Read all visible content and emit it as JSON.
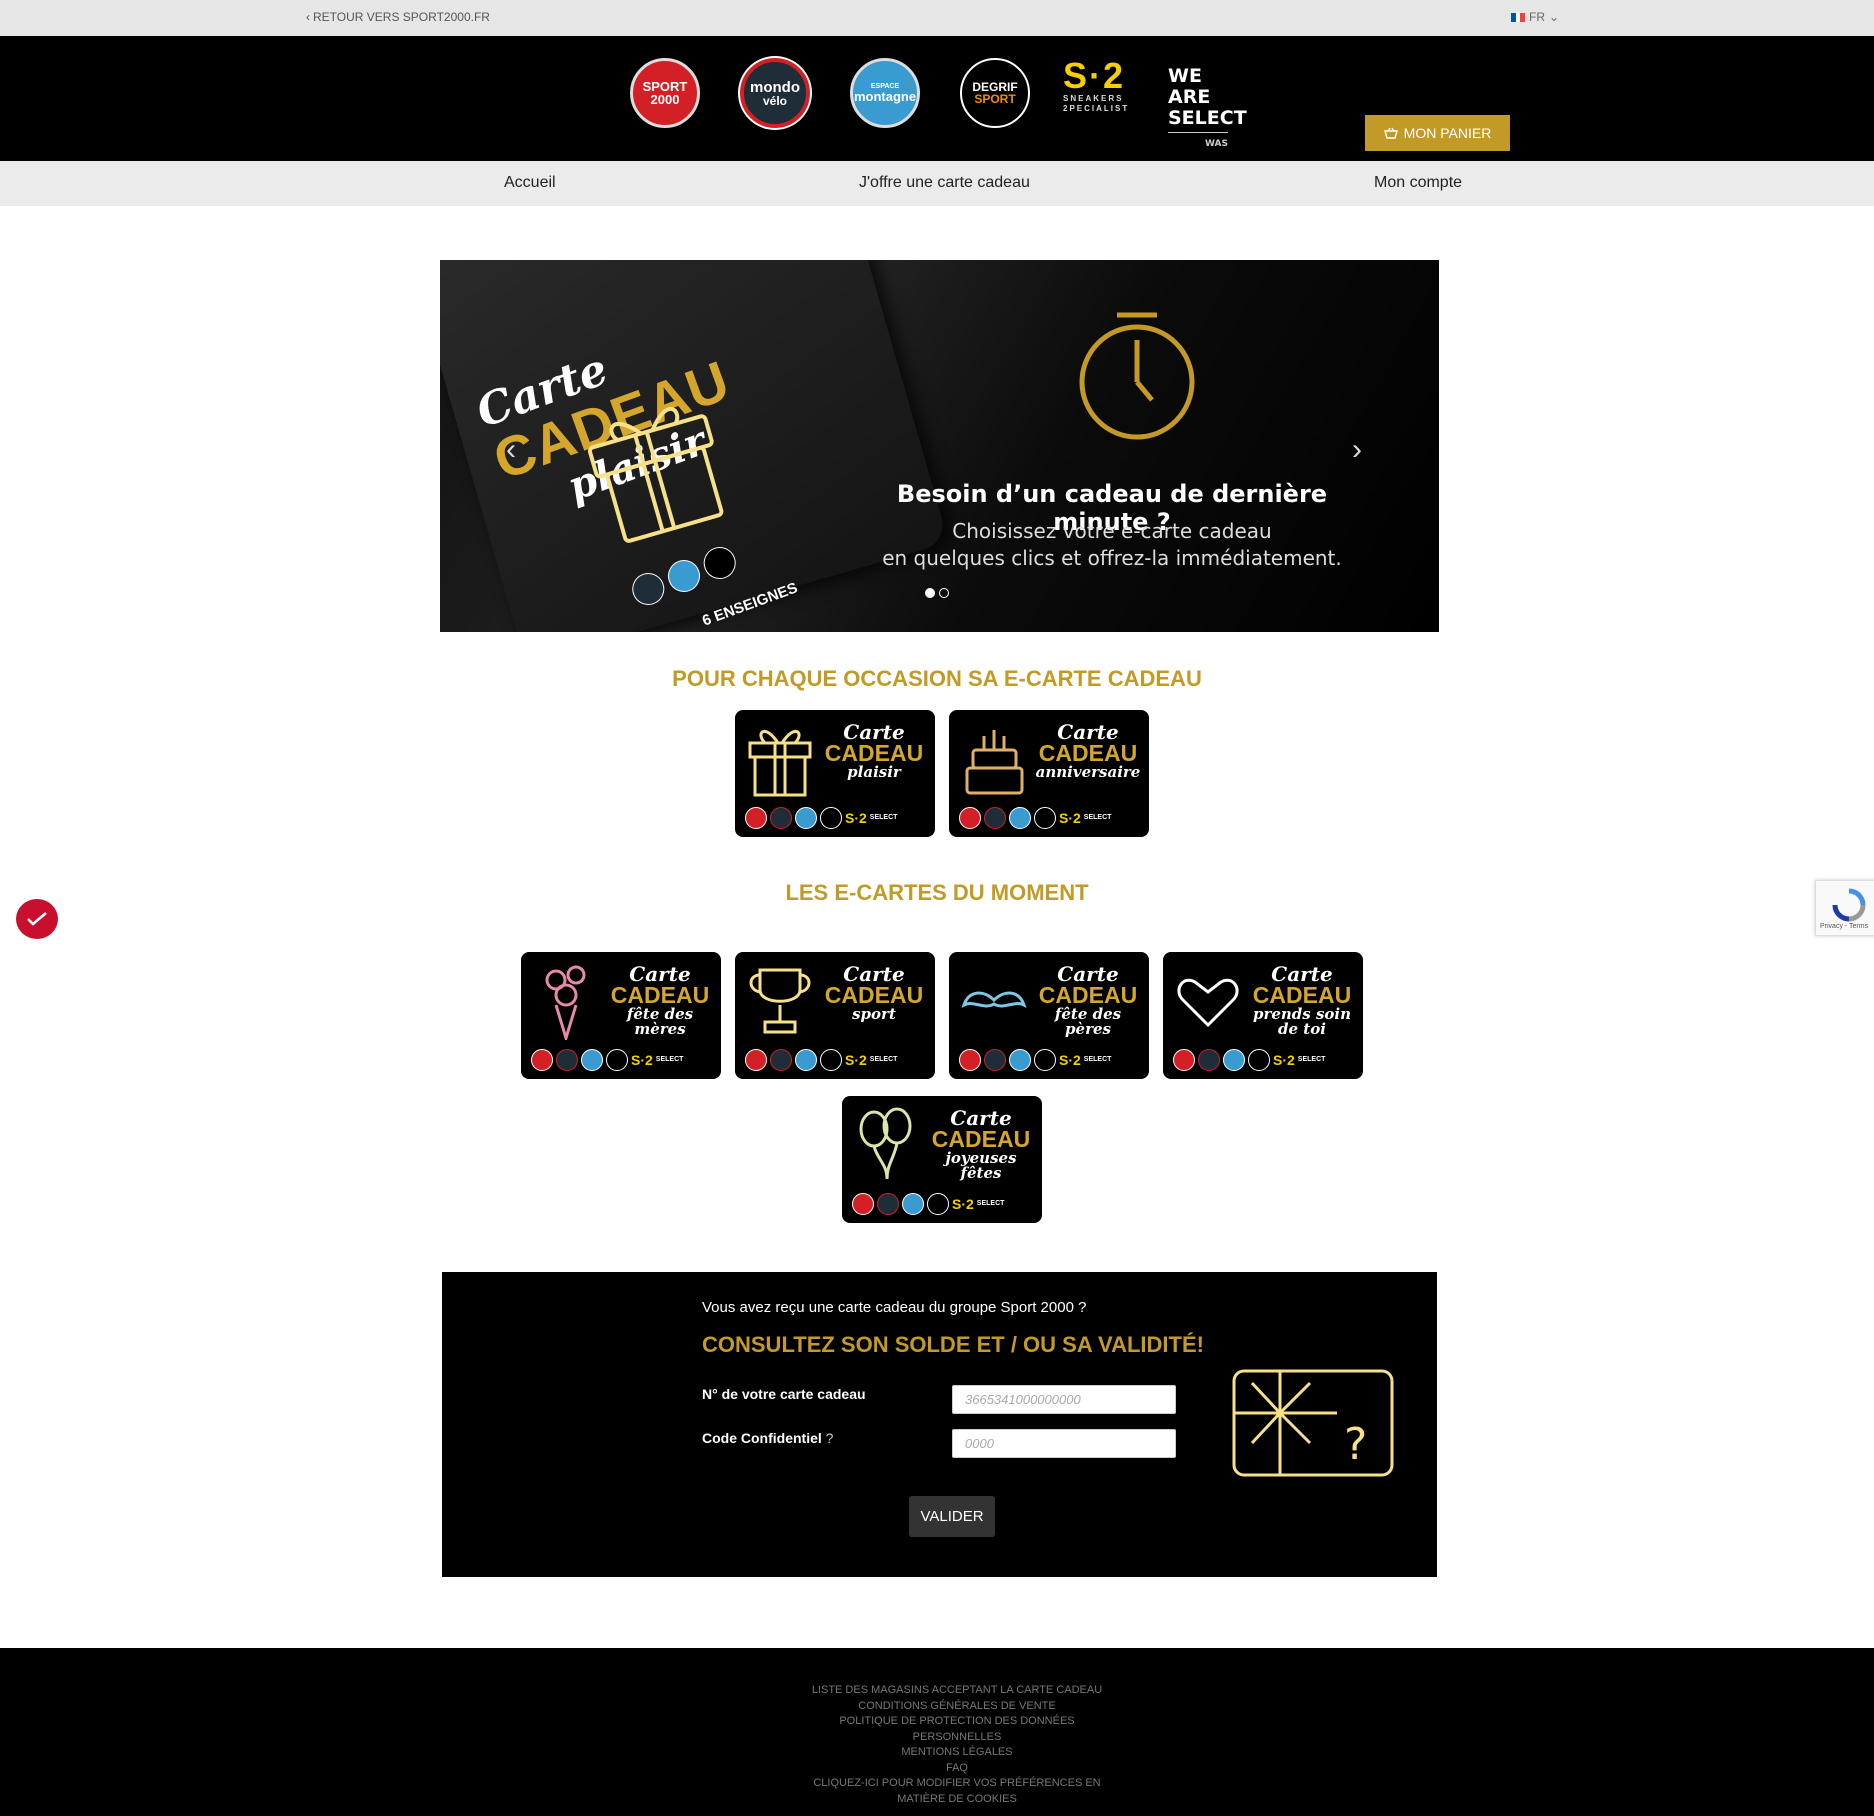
{
  "topbar": {
    "back_label": "RETOUR VERS SPORT2000.FR",
    "lang": "FR"
  },
  "brands": {
    "sport2000_l1": "SPORT",
    "sport2000_l2": "2000",
    "mondovelo_l1": "mondo",
    "mondovelo_l2": "vélo",
    "montagne_l1": "ESPACE",
    "montagne_l2": "montagne",
    "degrif_l1": "DEGRIF",
    "degrif_l2": "SPORT",
    "s2_big": "S·2",
    "s2_l1": "SNEAKERS",
    "s2_l2": "2PECIALIST",
    "was_l1": "WE ARE",
    "was_l2": "SELECT",
    "was_l3": "WAS"
  },
  "header": {
    "cart_label": "MON PANIER"
  },
  "nav": {
    "items": [
      "Accueil",
      "J'offre une carte cadeau",
      "Mon compte"
    ]
  },
  "hero": {
    "card_l1": "Carte",
    "card_l2": "CADEAU",
    "card_l3": "plaisir",
    "card_enseignes": "6 ENSEIGNES",
    "title": "Besoin d’un cadeau de dernière minute ?",
    "sub_l1": "Choisissez votre e-carte cadeau",
    "sub_l2": "en quelques clics et offrez-la immédiatement.",
    "slides": 2,
    "active_slide": 1
  },
  "occasion": {
    "title": "POUR CHAQUE OCCASION SA E-CARTE CADEAU",
    "cards": [
      {
        "l1": "Carte",
        "l2": "CADEAU",
        "l3": "plaisir"
      },
      {
        "l1": "Carte",
        "l2": "CADEAU",
        "l3": "anniversaire"
      }
    ]
  },
  "moment": {
    "title": "LES E-CARTES DU MOMENT",
    "cards": [
      {
        "l1": "Carte",
        "l2": "CADEAU",
        "l3": "fête des mères"
      },
      {
        "l1": "Carte",
        "l2": "CADEAU",
        "l3": "sport"
      },
      {
        "l1": "Carte",
        "l2": "CADEAU",
        "l3": "fête des pères"
      },
      {
        "l1": "Carte",
        "l2": "CADEAU",
        "l3": "prends soin de toi"
      },
      {
        "l1": "Carte",
        "l2": "CADEAU",
        "l3": "joyeuses fêtes"
      }
    ]
  },
  "balance": {
    "question": "Vous avez reçu une carte cadeau du groupe Sport 2000 ?",
    "title": "CONSULTEZ SON SOLDE ET / OU SA VALIDITÉ!",
    "card_number_label": "N° de votre carte cadeau",
    "card_number_placeholder": "3665341000000000",
    "code_label": "Code Confidentiel",
    "code_help": "?",
    "code_placeholder": "0000",
    "validate_label": "VALIDER"
  },
  "footer": {
    "links": [
      "LISTE DES MAGASINS ACCEPTANT LA CARTE CADEAU",
      "CONDITIONS GÉNÉRALES DE VENTE",
      "POLITIQUE DE PROTECTION DES DONNÉES",
      "PERSONNELLES",
      "MENTIONS LÉGALES",
      "FAQ",
      "CLIQUEZ-ICI POUR MODIFIER VOS PRÉFÉRENCES EN",
      "MATIÈRE DE COOKIES"
    ]
  },
  "recaptcha": {
    "text": "Privacy - Terms"
  },
  "colors": {
    "gold": "#c39a26",
    "black": "#000000",
    "light_gray": "#ebebeb"
  }
}
